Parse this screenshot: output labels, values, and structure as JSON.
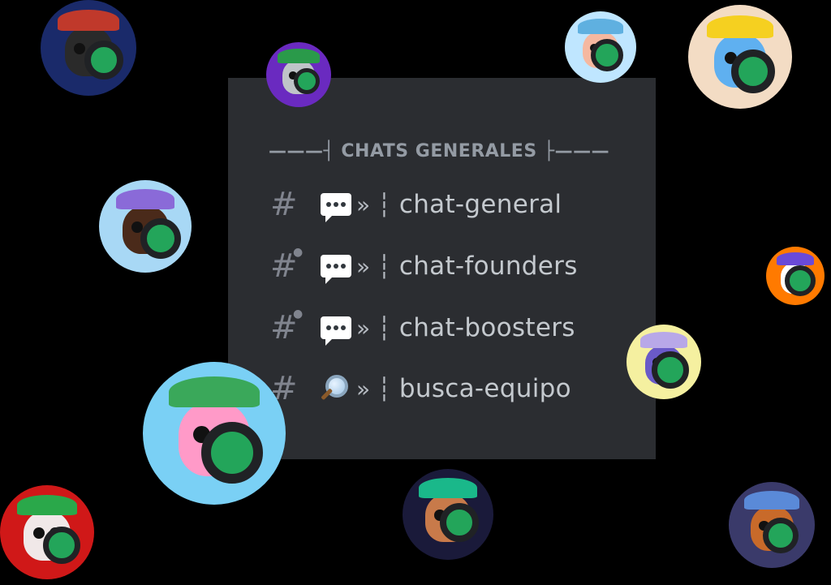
{
  "category": {
    "title": "———┤ CHATS GENERALES ├———"
  },
  "channels": [
    {
      "prefix": "#",
      "icon": "speech-bubble-icon",
      "separator": "» ┆",
      "name": "chat-general",
      "locked": false
    },
    {
      "prefix": "#",
      "icon": "speech-bubble-icon",
      "separator": "» ┆",
      "name": "chat-founders",
      "locked": true
    },
    {
      "prefix": "#",
      "icon": "speech-bubble-icon",
      "separator": "» ┆",
      "name": "chat-boosters",
      "locked": true
    },
    {
      "prefix": "#",
      "icon": "magnifying-glass-icon",
      "separator": "» ┆",
      "name": "busca-equipo",
      "locked": false
    }
  ],
  "colors": {
    "panel_bg": "#2b2d31",
    "online": "#23a55a",
    "text_muted": "#949ba4",
    "channel_text": "#c4c9ce"
  },
  "avatars": [
    {
      "name": "avatar-hooded-figure",
      "bg": "#1a2a6a",
      "face": "#2a2a2a",
      "hat": "#c0392b",
      "status": "online"
    },
    {
      "name": "avatar-purple-alien",
      "bg": "#6a2ac0",
      "face": "#bfc4c8",
      "hat": "#2a9a4a",
      "status": "online"
    },
    {
      "name": "avatar-sunglasses-kid",
      "bg": "#bfe6ff",
      "face": "#f5b8a0",
      "hat": "#5fb0e0",
      "status": "online"
    },
    {
      "name": "avatar-cap-cat",
      "bg": "#f3dcc4",
      "face": "#5fb0f0",
      "hat": "#f5d020",
      "status": "online"
    },
    {
      "name": "avatar-purple-hair-girl",
      "bg": "#a8d8f5",
      "face": "#4a2a1a",
      "hat": "#8a6ad8",
      "status": "online"
    },
    {
      "name": "avatar-zebra",
      "bg": "#ff7a00",
      "face": "#ffffff",
      "hat": "#6a4ad8",
      "status": "online"
    },
    {
      "name": "avatar-clown-cat",
      "bg": "#f5f0a0",
      "face": "#6a5ac8",
      "hat": "#b8a8e8",
      "status": "online"
    },
    {
      "name": "avatar-propeller-ape",
      "bg": "#7ad0f5",
      "face": "#ff9ac8",
      "hat": "#3aa85a",
      "status": "online"
    },
    {
      "name": "avatar-joker",
      "bg": "#d01818",
      "face": "#f0e8e8",
      "hat": "#2aa84a",
      "status": "online"
    },
    {
      "name": "avatar-green-cap-boy",
      "bg": "#1a1a3a",
      "face": "#c87a4a",
      "hat": "#1ab88a",
      "status": "online"
    },
    {
      "name": "avatar-orange-ape",
      "bg": "#3a3a6a",
      "face": "#c86a2a",
      "hat": "#5a8ad8",
      "status": "online"
    }
  ]
}
